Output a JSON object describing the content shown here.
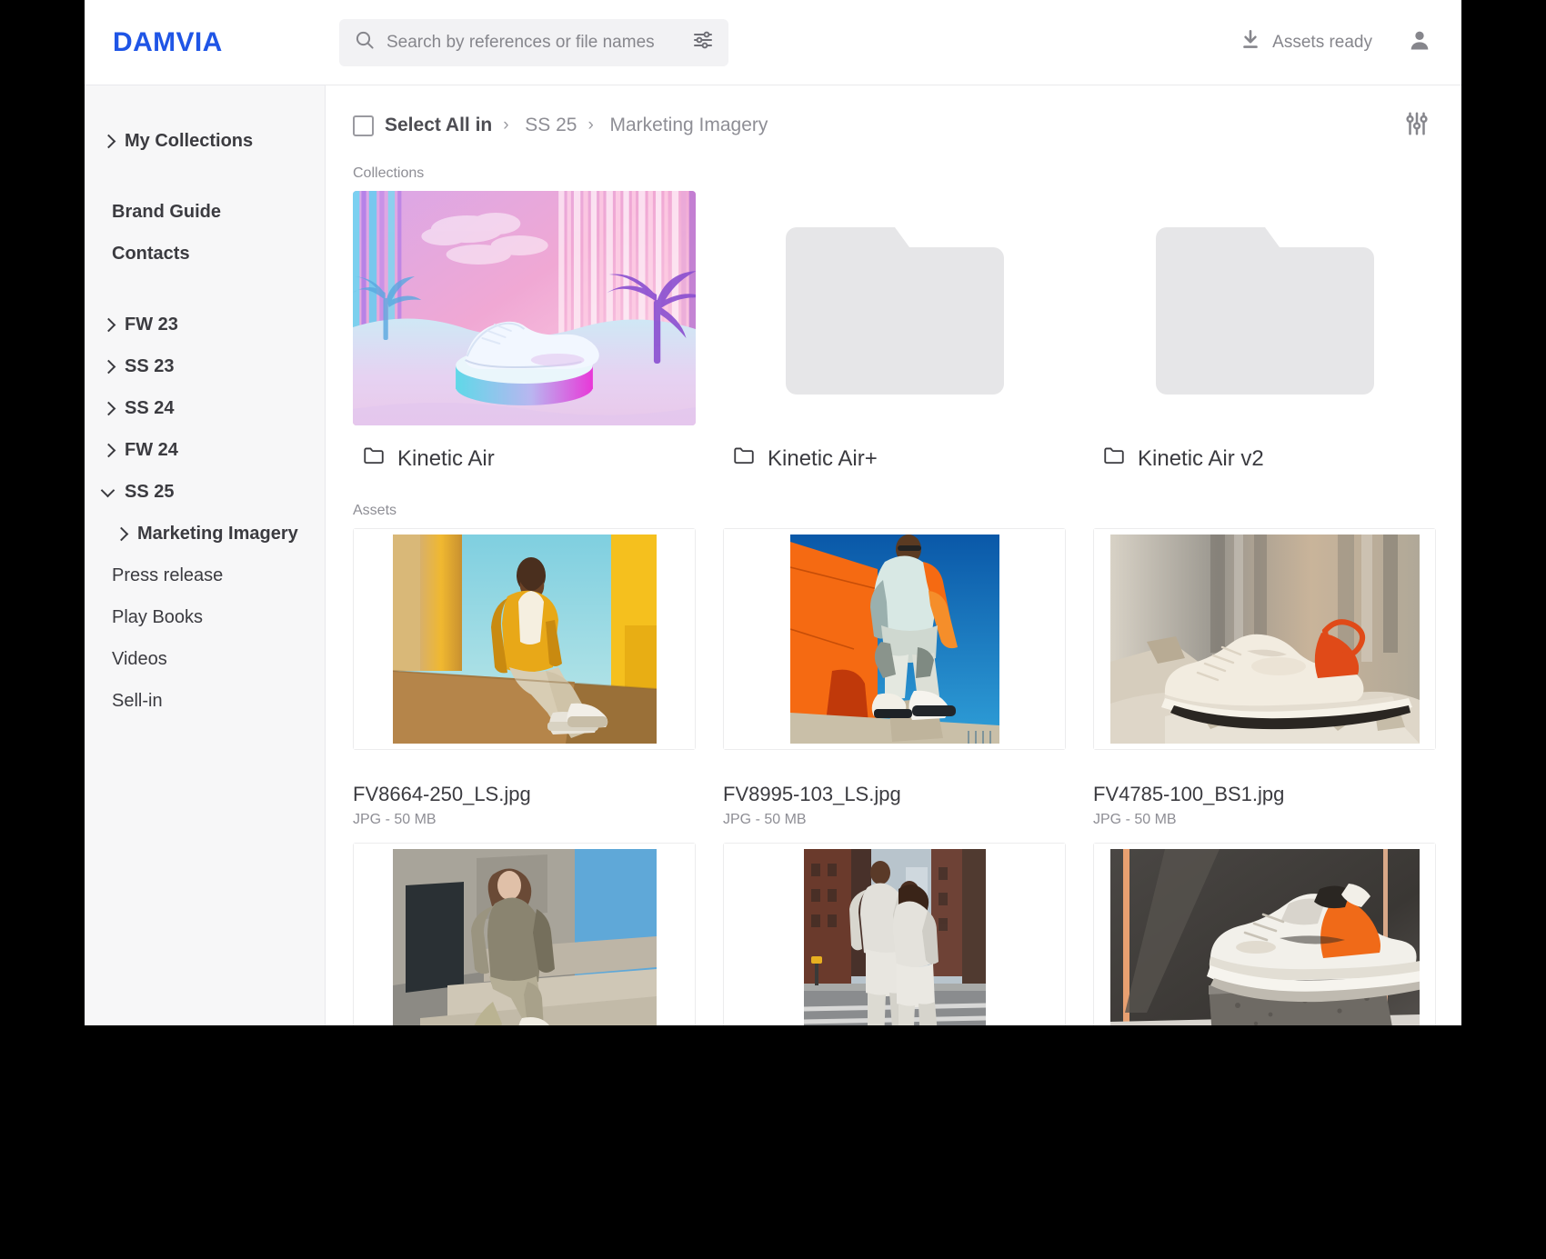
{
  "brand": {
    "name": "DAMVIA",
    "color": "#1f55e6"
  },
  "header": {
    "search": {
      "placeholder": "Search by references or file names",
      "value": ""
    },
    "search_icon": "search-icon",
    "filter_icon": "sliders-icon",
    "assets_ready_label": "Assets ready",
    "download_icon": "download-icon",
    "account_icon": "user-icon"
  },
  "sidebar": {
    "items": [
      {
        "label": "My Collections",
        "type": "expandable",
        "state": "collapsed",
        "level": 0,
        "bold": true
      },
      {
        "label": "Brand Guide",
        "type": "link",
        "level": 0,
        "bold": true
      },
      {
        "label": "Contacts",
        "type": "link",
        "level": 0,
        "bold": true
      },
      {
        "label": "FW 23",
        "type": "expandable",
        "state": "collapsed",
        "level": 0,
        "bold": true
      },
      {
        "label": "SS 23",
        "type": "expandable",
        "state": "collapsed",
        "level": 0,
        "bold": true
      },
      {
        "label": "SS 24",
        "type": "expandable",
        "state": "collapsed",
        "level": 0,
        "bold": true
      },
      {
        "label": "FW 24",
        "type": "expandable",
        "state": "collapsed",
        "level": 0,
        "bold": true
      },
      {
        "label": "SS 25",
        "type": "expandable",
        "state": "expanded",
        "level": 0,
        "bold": true
      },
      {
        "label": "Marketing Imagery",
        "type": "expandable",
        "state": "collapsed",
        "level": 1,
        "bold": true,
        "active": true
      },
      {
        "label": "Press release",
        "type": "link",
        "level": 1,
        "bold": false
      },
      {
        "label": "Play Books",
        "type": "link",
        "level": 1,
        "bold": false
      },
      {
        "label": "Videos",
        "type": "link",
        "level": 1,
        "bold": false
      },
      {
        "label": "Sell-in",
        "type": "link",
        "level": 1,
        "bold": false
      }
    ]
  },
  "toolbar": {
    "select_all_label": "Select All in",
    "checkbox_checked": false,
    "breadcrumb": [
      "SS 25",
      "Marketing Imagery"
    ],
    "separator": "›",
    "filter_icon": "sliders-icon"
  },
  "collections": {
    "section_label": "Collections",
    "folders": [
      {
        "name": "Kinetic Air",
        "thumb": "vaporwave-sneaker",
        "has_preview": true
      },
      {
        "name": "Kinetic Air+",
        "thumb": "empty-folder",
        "has_preview": false
      },
      {
        "name": "Kinetic Air v2",
        "thumb": "empty-folder",
        "has_preview": false
      }
    ],
    "folder_icon": "folder-icon"
  },
  "assets": {
    "section_label": "Assets",
    "items": [
      {
        "name": "FV8664-250_LS.jpg",
        "meta": "JPG - 50 MB",
        "thumb": "man-yellow-jacket-columns"
      },
      {
        "name": "FV8995-103_LS.jpg",
        "meta": "JPG - 50 MB",
        "thumb": "man-orange-wall-blue-sky"
      },
      {
        "name": "FV4785-100_BS1.jpg",
        "meta": "JPG - 50 MB",
        "thumb": "cream-sneaker-rubble"
      },
      {
        "name": "",
        "meta": "",
        "thumb": "woman-concrete-steps"
      },
      {
        "name": "",
        "meta": "",
        "thumb": "two-people-city-street"
      },
      {
        "name": "",
        "meta": "",
        "thumb": "orange-sneaker-concrete-block"
      }
    ]
  }
}
